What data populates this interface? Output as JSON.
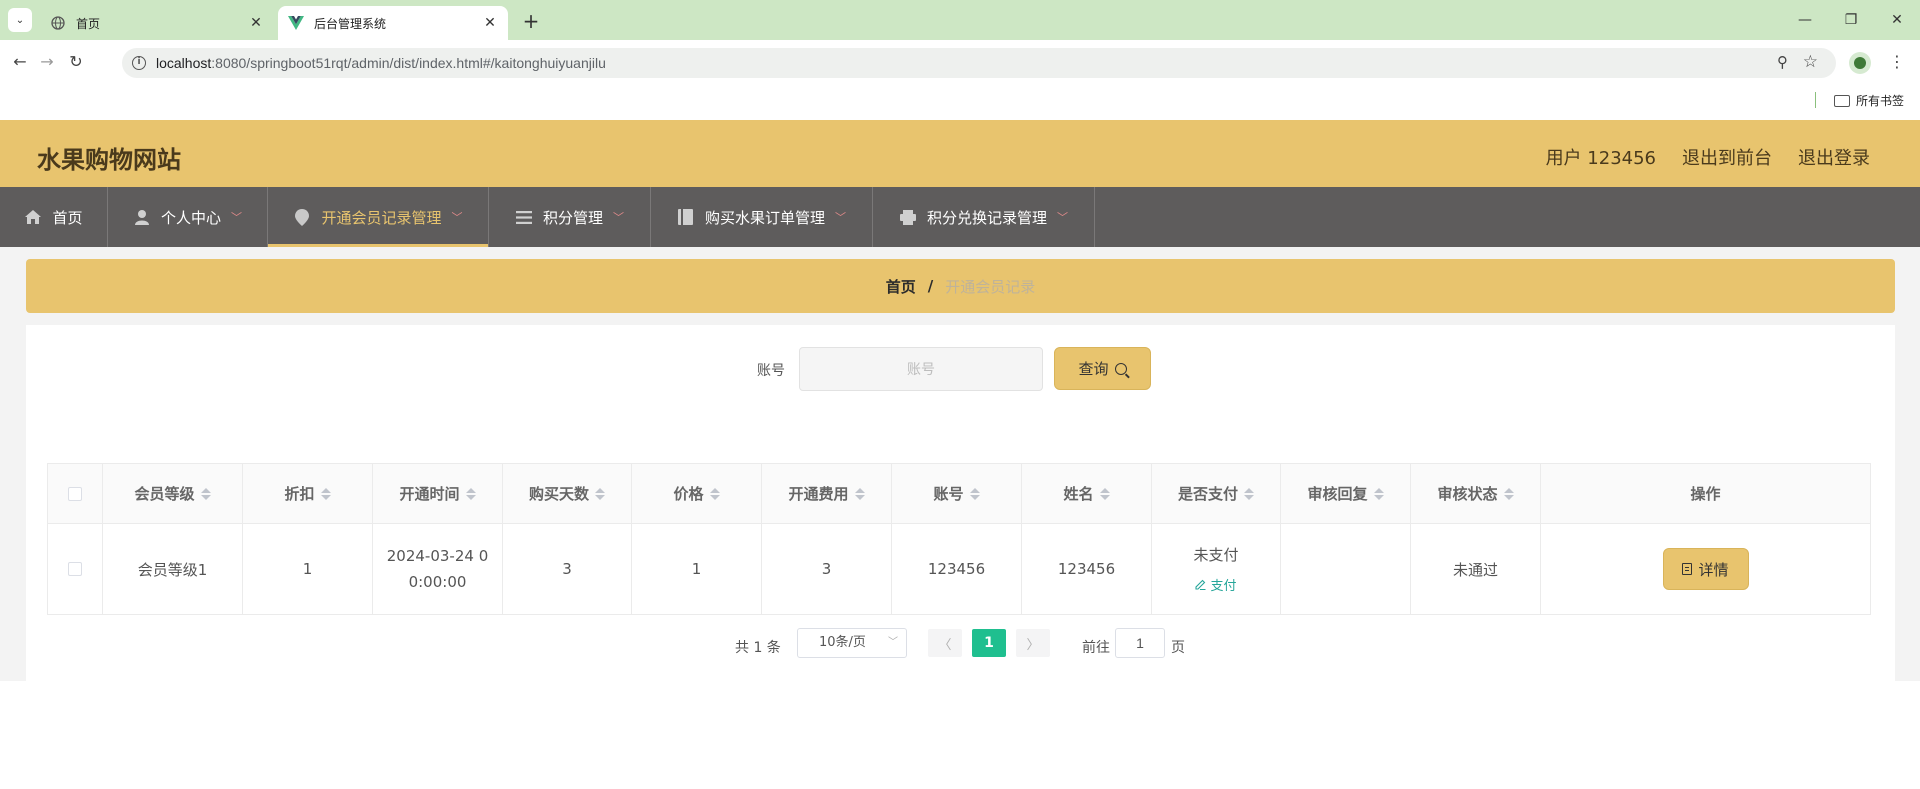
{
  "browser": {
    "tabs": [
      {
        "title": "首页",
        "icon": "globe-icon",
        "active": false
      },
      {
        "title": "后台管理系统",
        "icon": "vue-logo-icon",
        "active": true
      }
    ],
    "url_host": "localhost",
    "url_path": ":8080/springboot51rqt/admin/dist/index.html#/kaitonghuiyuanjilu",
    "bookmark_folder": "所有书签"
  },
  "header": {
    "site_title": "水果购物网站",
    "user_label": "用户 123456",
    "back_to_front": "退出到前台",
    "logout": "退出登录"
  },
  "menu": [
    {
      "label": "首页",
      "icon": "home-icon",
      "has_caret": false,
      "active": false
    },
    {
      "label": "个人中心",
      "icon": "user-icon",
      "has_caret": true,
      "active": false
    },
    {
      "label": "开通会员记录管理",
      "icon": "pin-icon",
      "has_caret": true,
      "active": true
    },
    {
      "label": "积分管理",
      "icon": "list-icon",
      "has_caret": true,
      "active": false
    },
    {
      "label": "购买水果订单管理",
      "icon": "book-icon",
      "has_caret": true,
      "active": false
    },
    {
      "label": "积分兑换记录管理",
      "icon": "printer-icon",
      "has_caret": true,
      "active": false
    }
  ],
  "breadcrumb": {
    "home": "首页",
    "separator": "/",
    "current": "开通会员记录"
  },
  "search": {
    "label": "账号",
    "placeholder": "账号",
    "button": "查询"
  },
  "table": {
    "columns": [
      "会员等级",
      "折扣",
      "开通时间",
      "购买天数",
      "价格",
      "开通费用",
      "账号",
      "姓名",
      "是否支付",
      "审核回复",
      "审核状态",
      "操作"
    ],
    "rows": [
      {
        "level": "会员等级1",
        "discount": "1",
        "open_time_line1": "2024-03-24 0",
        "open_time_line2": "0:00:00",
        "days": "3",
        "price": "1",
        "fee": "3",
        "account": "123456",
        "name": "123456",
        "paid": "未支付",
        "pay_action": "支付",
        "review_reply": "",
        "review_status": "未通过",
        "action": "详情"
      }
    ]
  },
  "pagination": {
    "total": "共 1 条",
    "page_size": "10条/页",
    "current_page": "1",
    "goto_label": "前往",
    "goto_value": "1",
    "goto_unit": "页"
  },
  "colors": {
    "accent": "#e8c46e",
    "menu_bg": "#5e5c5c",
    "page_active": "#1fbf8f",
    "pay_link": "#26a69a"
  }
}
